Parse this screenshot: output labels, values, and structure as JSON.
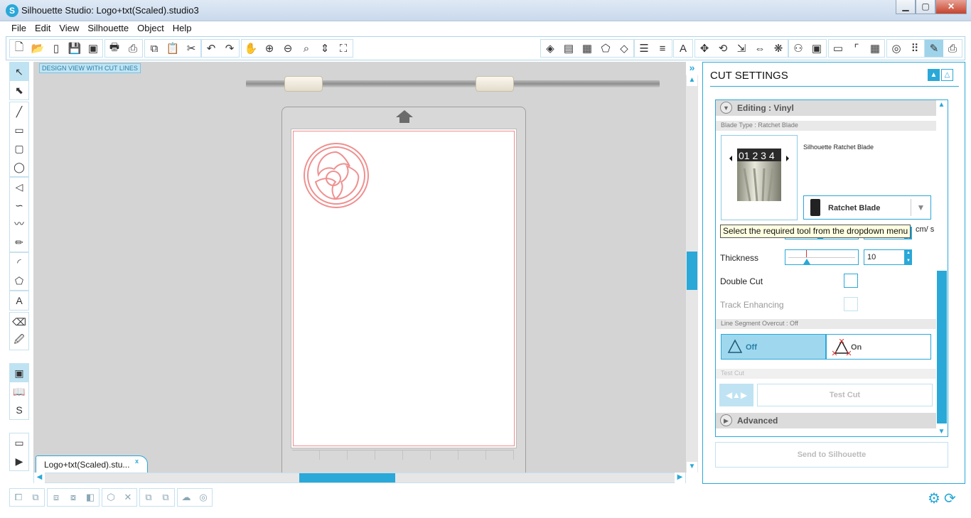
{
  "window": {
    "title": "Silhouette Studio: Logo+txt(Scaled).studio3",
    "logo_glyph": "S",
    "min": "▁",
    "max": "▢",
    "close": "✕"
  },
  "menu": [
    "File",
    "Edit",
    "View",
    "Silhouette",
    "Object",
    "Help"
  ],
  "toolbar": {
    "file_group": [
      {
        "icon": "new-document-icon",
        "glyph": "🗋"
      },
      {
        "icon": "open-folder-icon",
        "glyph": "📂"
      },
      {
        "icon": "open-library-icon",
        "glyph": "▯"
      },
      {
        "icon": "save-icon",
        "glyph": "💾"
      },
      {
        "icon": "save-to-library-icon",
        "glyph": "▣"
      }
    ],
    "print_group": [
      {
        "icon": "print-icon",
        "glyph": "🖶"
      },
      {
        "icon": "print-cut-icon",
        "glyph": "⎙"
      }
    ],
    "edit_group": [
      {
        "icon": "copy-icon",
        "glyph": "⧉"
      },
      {
        "icon": "paste-icon",
        "glyph": "📋"
      },
      {
        "icon": "cut-icon",
        "glyph": "✂"
      }
    ],
    "undo_group": [
      {
        "icon": "undo-icon",
        "glyph": "↶"
      },
      {
        "icon": "redo-icon",
        "glyph": "↷"
      }
    ],
    "view_group": [
      {
        "icon": "pan-hand-icon",
        "glyph": "✋"
      },
      {
        "icon": "zoom-in-icon",
        "glyph": "⊕"
      },
      {
        "icon": "zoom-out-icon",
        "glyph": "⊖"
      },
      {
        "icon": "zoom-select-icon",
        "glyph": "⌕"
      },
      {
        "icon": "drag-zoom-icon",
        "glyph": "⇕"
      },
      {
        "icon": "fit-to-page-icon",
        "glyph": "⛶"
      }
    ],
    "right_group1": [
      {
        "icon": "fill-color-icon",
        "glyph": "◈"
      },
      {
        "icon": "gradient-fill-icon",
        "glyph": "▤"
      },
      {
        "icon": "pattern-fill-icon",
        "glyph": "▦"
      },
      {
        "icon": "line-color-icon",
        "glyph": "⬠"
      },
      {
        "icon": "line-style-icon",
        "glyph": "◇"
      }
    ],
    "right_group2": [
      {
        "icon": "line-color-bars-icon",
        "glyph": "☰"
      },
      {
        "icon": "line-style-bars-icon",
        "glyph": "≡"
      }
    ],
    "right_group3": [
      {
        "icon": "text-style-icon",
        "glyph": "A"
      }
    ],
    "right_group4": [
      {
        "icon": "transform-icon",
        "glyph": "✥"
      },
      {
        "icon": "rotate-icon",
        "glyph": "⟲"
      },
      {
        "icon": "scale-icon",
        "glyph": "⇲"
      },
      {
        "icon": "move-icon",
        "glyph": "⇔"
      },
      {
        "icon": "replicate-icon",
        "glyph": "❋"
      }
    ],
    "right_group5": [
      {
        "icon": "store-icon",
        "glyph": "⚇"
      },
      {
        "icon": "library-icon",
        "glyph": "▣"
      }
    ],
    "right_group6": [
      {
        "icon": "page-setup-icon",
        "glyph": "▭"
      },
      {
        "icon": "registration-marks-icon",
        "glyph": "⌜"
      },
      {
        "icon": "grid-icon",
        "glyph": "▦"
      }
    ],
    "right_group7": [
      {
        "icon": "trace-icon",
        "glyph": "◎"
      },
      {
        "icon": "offset-icon",
        "glyph": "⠿"
      }
    ],
    "right_group8": [
      {
        "icon": "cut-settings-icon",
        "glyph": "✎"
      },
      {
        "icon": "send-to-silhouette-icon",
        "glyph": "⎙"
      }
    ]
  },
  "left_tools": {
    "group1": [
      {
        "icon": "select-arrow-icon",
        "glyph": "↖"
      },
      {
        "icon": "edit-points-icon",
        "glyph": "⬉"
      }
    ],
    "group2": [
      {
        "icon": "line-tool-icon",
        "glyph": "╱"
      },
      {
        "icon": "rectangle-tool-icon",
        "glyph": "▭"
      },
      {
        "icon": "rounded-rectangle-tool-icon",
        "glyph": "▢"
      },
      {
        "icon": "ellipse-tool-icon",
        "glyph": "◯"
      }
    ],
    "group3": [
      {
        "icon": "polygon-tool-icon",
        "glyph": "◁"
      },
      {
        "icon": "curve-tool-icon",
        "glyph": "∽"
      },
      {
        "icon": "freehand-tool-icon",
        "glyph": "〰"
      },
      {
        "icon": "smooth-freehand-icon",
        "glyph": "✏"
      }
    ],
    "group4": [
      {
        "icon": "arc-tool-icon",
        "glyph": "◜"
      },
      {
        "icon": "regular-polygon-icon",
        "glyph": "⬠"
      }
    ],
    "group5": [
      {
        "icon": "text-tool-icon",
        "glyph": "A"
      }
    ],
    "group6": [
      {
        "icon": "eraser-tool-icon",
        "glyph": "⌫"
      },
      {
        "icon": "knife-tool-icon",
        "glyph": "🖉"
      }
    ],
    "group7": [
      {
        "icon": "design-page-icon",
        "glyph": "▣"
      },
      {
        "icon": "library-book-icon",
        "glyph": "📖"
      },
      {
        "icon": "silhouette-store-icon",
        "glyph": "S"
      }
    ],
    "group8": [
      {
        "icon": "window-panel-icon",
        "glyph": "▭"
      },
      {
        "icon": "play-icon",
        "glyph": "▶"
      }
    ]
  },
  "workspace": {
    "view_label": "DESIGN VIEW WITH CUT LINES",
    "doc_tab": "Logo+txt(Scaled).stu...",
    "doc_tab_close": "x"
  },
  "bottom_toolbar": {
    "group1": [
      {
        "icon": "group-icon",
        "glyph": "⧠"
      },
      {
        "icon": "ungroup-icon",
        "glyph": "⧉"
      }
    ],
    "group2": [
      {
        "icon": "make-compound-icon",
        "glyph": "⧈"
      },
      {
        "icon": "release-compound-icon",
        "glyph": "⧇"
      },
      {
        "icon": "bring-front-icon",
        "glyph": "◧"
      }
    ],
    "group3": [
      {
        "icon": "weld-icon",
        "glyph": "⬡"
      },
      {
        "icon": "delete-icon",
        "glyph": "✕"
      }
    ],
    "group4": [
      {
        "icon": "duplicate-left-icon",
        "glyph": "⧉"
      },
      {
        "icon": "duplicate-right-icon",
        "glyph": "⧉"
      }
    ],
    "group5": [
      {
        "icon": "cloud-icon",
        "glyph": "☁"
      },
      {
        "icon": "spiral-icon",
        "glyph": "◎"
      }
    ],
    "settings_glyph": "⚙",
    "sync_glyph": "⟳"
  },
  "cut_panel": {
    "title": "CUT SETTINGS",
    "editing_label": "Editing : Vinyl",
    "blade_type_label": "Blade Type : Ratchet Blade",
    "blade_name": "Silhouette Ratchet Blade",
    "blade_scale": "01 2 3 4",
    "blade_select": "Ratchet Blade",
    "speed_unit": "cm/ s",
    "thickness_label": "Thickness",
    "thickness_value": "10",
    "double_cut_label": "Double Cut",
    "track_label": "Track Enhancing",
    "overcut_label": "Line Segment Overcut : Off",
    "overcut_off": "Off",
    "overcut_on": "On",
    "test_cut_header": "Test Cut",
    "test_cut_button": "Test Cut",
    "advanced_label": "Advanced",
    "send_button": "Send to Silhouette",
    "tooltip": "Select the required tool from the dropdown menu"
  },
  "colors": {
    "accent": "#2aa8d8",
    "cut_line": "#ef8b8b"
  }
}
